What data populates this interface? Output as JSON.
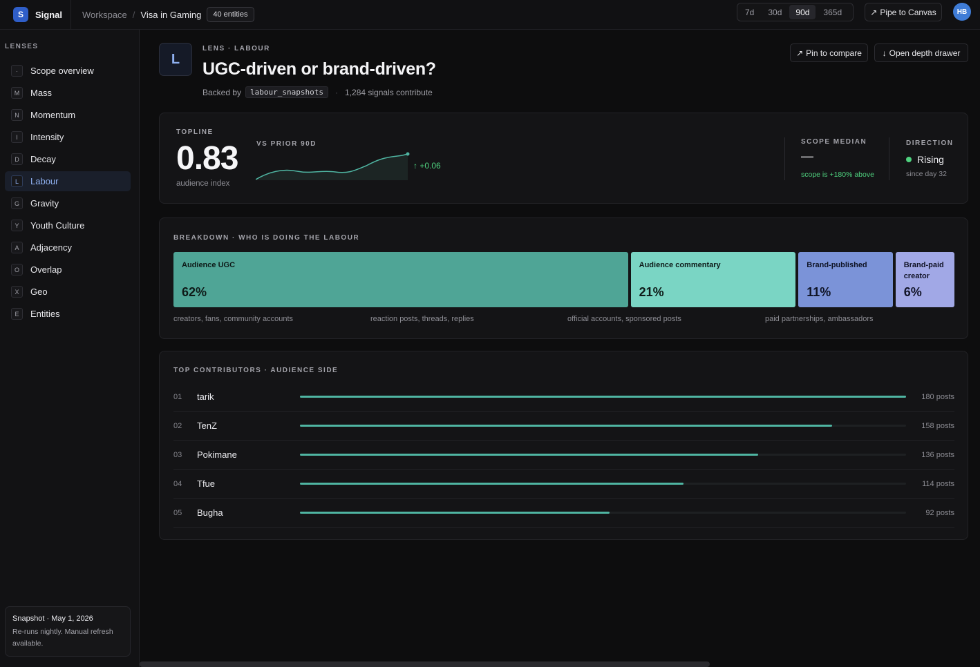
{
  "topbar": {
    "logo_letter": "S",
    "brand": "Signal",
    "crumb_workspace": "Workspace",
    "crumb_sep": "/",
    "crumb_current": "Visa in Gaming",
    "entities_pill": "40 entities",
    "ranges": [
      "7d",
      "30d",
      "90d",
      "365d"
    ],
    "active_range": "90d",
    "pipe_icon": "↗",
    "pipe_label": "Pipe to Canvas",
    "avatar": "HB"
  },
  "sidebar": {
    "title": "LENSES",
    "items": [
      {
        "badge": "·",
        "label": "Scope overview"
      },
      {
        "badge": "M",
        "label": "Mass"
      },
      {
        "badge": "N",
        "label": "Momentum"
      },
      {
        "badge": "I",
        "label": "Intensity"
      },
      {
        "badge": "D",
        "label": "Decay"
      },
      {
        "badge": "L",
        "label": "Labour"
      },
      {
        "badge": "G",
        "label": "Gravity"
      },
      {
        "badge": "Y",
        "label": "Youth Culture"
      },
      {
        "badge": "A",
        "label": "Adjacency"
      },
      {
        "badge": "O",
        "label": "Overlap"
      },
      {
        "badge": "X",
        "label": "Geo"
      },
      {
        "badge": "E",
        "label": "Entities"
      }
    ],
    "active_item": "Labour",
    "snapshot_title": "Snapshot · May 1, 2026",
    "snapshot_body": "Re-runs nightly. Manual refresh available."
  },
  "header": {
    "icon_letter": "L",
    "eyebrow": "LENS · LABOUR",
    "title": "UGC-driven or brand-driven?",
    "backed_by": "Backed by",
    "table": "labour_snapshots",
    "dot": "·",
    "signals": "1,284 signals contribute",
    "pin_icon": "↗",
    "pin_label": "Pin to compare",
    "open_icon": "↓",
    "open_label": "Open depth drawer"
  },
  "topline": {
    "label": "TOPLINE",
    "value": "0.83",
    "caption": "audience index",
    "vs_label": "VS PRIOR 90D",
    "delta": "↑ +0.06",
    "scope_label": "SCOPE MEDIAN",
    "scope_value": "—",
    "scope_note": "scope is +180% above",
    "direction_label": "DIRECTION",
    "direction_value": "Rising",
    "direction_note": "since day 32",
    "accent": "#4fb5a2",
    "positive": "#4fd27f"
  },
  "breakdown": {
    "label": "BREAKDOWN · WHO IS DOING THE LABOUR",
    "segments": [
      {
        "name": "Audience UGC",
        "pct": "62%",
        "share": 62,
        "color": "#4fa596",
        "text": "#0e1a18",
        "desc": "creators, fans, community accounts"
      },
      {
        "name": "Audience commentary",
        "pct": "21%",
        "share": 21,
        "color": "#7ad5c4",
        "text": "#0e1a18",
        "desc": "reaction posts, threads, replies"
      },
      {
        "name": "Brand-published",
        "pct": "11%",
        "share": 11,
        "color": "#7b93d8",
        "text": "#0f1426",
        "desc": "official accounts, sponsored posts"
      },
      {
        "name": "Brand-paid creator",
        "pct": "6%",
        "share": 6,
        "color": "#a1a8e6",
        "text": "#121428",
        "desc": "paid partnerships, ambassadors"
      }
    ]
  },
  "contributors": {
    "label": "TOP CONTRIBUTORS · AUDIENCE SIDE",
    "max_posts": 180,
    "rows": [
      {
        "rank": "01",
        "name": "tarik",
        "posts": 180,
        "posts_label": "180 posts"
      },
      {
        "rank": "02",
        "name": "TenZ",
        "posts": 158,
        "posts_label": "158 posts"
      },
      {
        "rank": "03",
        "name": "Pokimane",
        "posts": 136,
        "posts_label": "136 posts"
      },
      {
        "rank": "04",
        "name": "Tfue",
        "posts": 114,
        "posts_label": "114 posts"
      },
      {
        "rank": "05",
        "name": "Bugha",
        "posts": 92,
        "posts_label": "92 posts"
      }
    ]
  }
}
